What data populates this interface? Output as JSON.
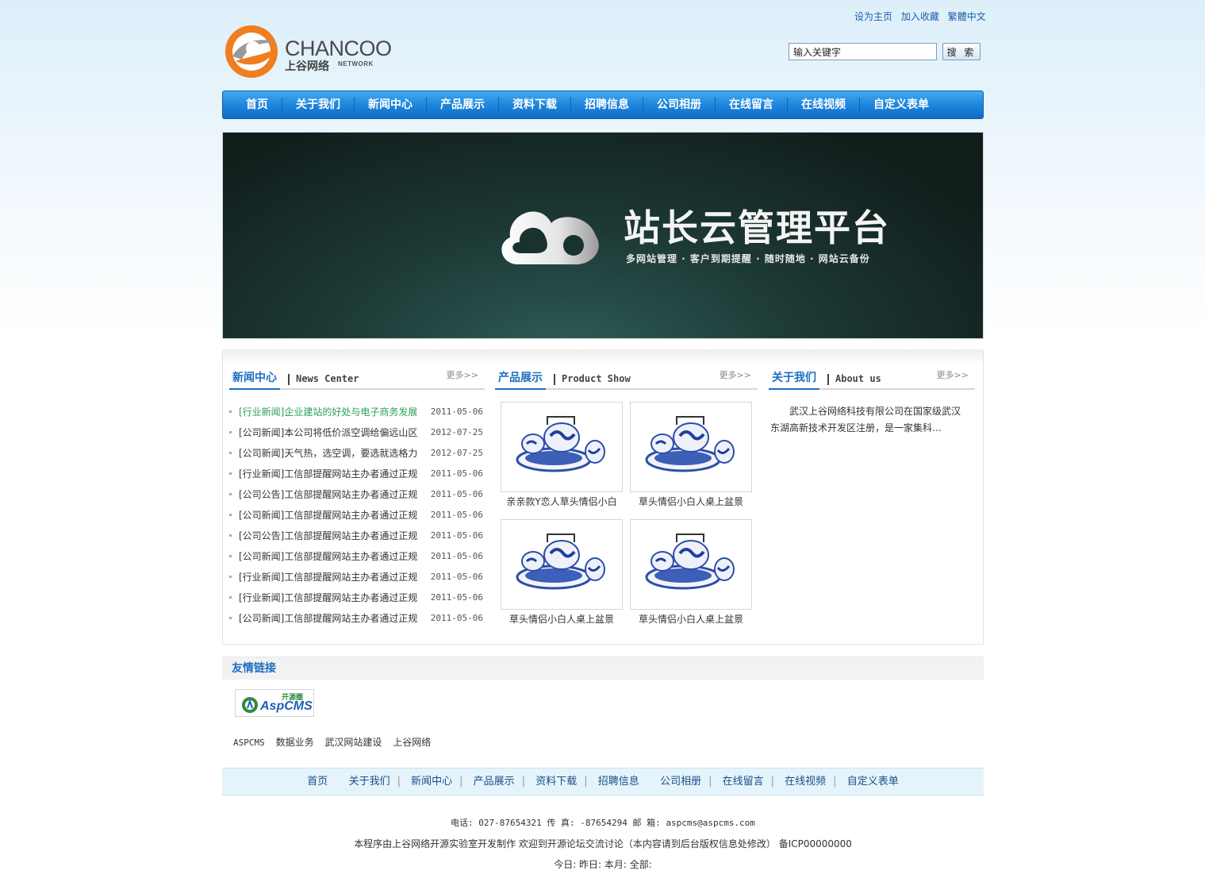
{
  "top_links": [
    "设为主页",
    "加入收藏",
    "繁體中文"
  ],
  "logo": {
    "brand_en": "CHANCOO",
    "brand_cn": "上谷网络",
    "network": "NETWORK"
  },
  "search": {
    "value": "输入关键字",
    "button": "搜 索"
  },
  "nav": [
    "首页",
    "关于我们",
    "新闻中心",
    "产品展示",
    "资料下载",
    "招聘信息",
    "公司相册",
    "在线留言",
    "在线视频",
    "自定义表单"
  ],
  "banner": {
    "title": "站长云管理平台",
    "subtitle": "多网站管理 · 客户到期提醒 · 随时随地 · 网站云备份"
  },
  "news": {
    "title_cn": "新闻中心",
    "title_en": "News Center",
    "more": "更多>>",
    "items": [
      {
        "title": "[行业新闻]企业建站的好处与电子商务发展",
        "date": "2011-05-06"
      },
      {
        "title": "[公司新闻]本公司将低价派空调给偏远山区",
        "date": "2012-07-25"
      },
      {
        "title": "[公司新闻]天气热，选空调，要选就选格力",
        "date": "2012-07-25"
      },
      {
        "title": "[行业新闻]工信部提醒网站主办者通过正规",
        "date": "2011-05-06"
      },
      {
        "title": "[公司公告]工信部提醒网站主办者通过正规",
        "date": "2011-05-06"
      },
      {
        "title": "[公司新闻]工信部提醒网站主办者通过正规",
        "date": "2011-05-06"
      },
      {
        "title": "[公司公告]工信部提醒网站主办者通过正规",
        "date": "2011-05-06"
      },
      {
        "title": "[公司新闻]工信部提醒网站主办者通过正规",
        "date": "2011-05-06"
      },
      {
        "title": "[行业新闻]工信部提醒网站主办者通过正规",
        "date": "2011-05-06"
      },
      {
        "title": "[行业新闻]工信部提醒网站主办者通过正规",
        "date": "2011-05-06"
      },
      {
        "title": "[公司新闻]工信部提醒网站主办者通过正规",
        "date": "2011-05-06"
      }
    ]
  },
  "products": {
    "title_cn": "产品展示",
    "title_en": "Product Show",
    "more": "更多>>",
    "items": [
      {
        "caption": "亲亲款Y恋人草头情侣小白"
      },
      {
        "caption": "草头情侣小白人桌上盆景"
      },
      {
        "caption": "草头情侣小白人桌上盆景"
      },
      {
        "caption": "草头情侣小白人桌上盆景"
      }
    ]
  },
  "about": {
    "title_cn": "关于我们",
    "title_en": "About us",
    "more": "更多>>",
    "text": "武汉上谷网络科技有限公司在国家级武汉东湖高新技术开发区注册，是一家集科…"
  },
  "friend": {
    "title": "友情链接",
    "logo": {
      "badge": "开源圈",
      "name": "AspCMS"
    },
    "texts": [
      "ASPCMS",
      "数据业务",
      "武汉网站建设",
      "上谷网络"
    ]
  },
  "footer_nav": [
    "首页",
    "关于我们",
    "新闻中心",
    "产品展示",
    "资料下载",
    "招聘信息",
    "公司相册",
    "在线留言",
    "在线视频",
    "自定义表单"
  ],
  "footer": {
    "contact": "电话: 027-87654321 传 真: -87654294 邮 箱: aspcms@aspcms.com",
    "copyright": "本程序由上谷网络开源实验室开发制作 欢迎到开源论坛交流讨论（本内容请到后台版权信息处修改） 备ICP00000000",
    "stats": "今日:  昨日:  本月:  全部:"
  },
  "colors": {
    "nav_blue": "#1f86dc",
    "accent": "#1d6fc0",
    "logo_orange": "#f07d1e"
  }
}
